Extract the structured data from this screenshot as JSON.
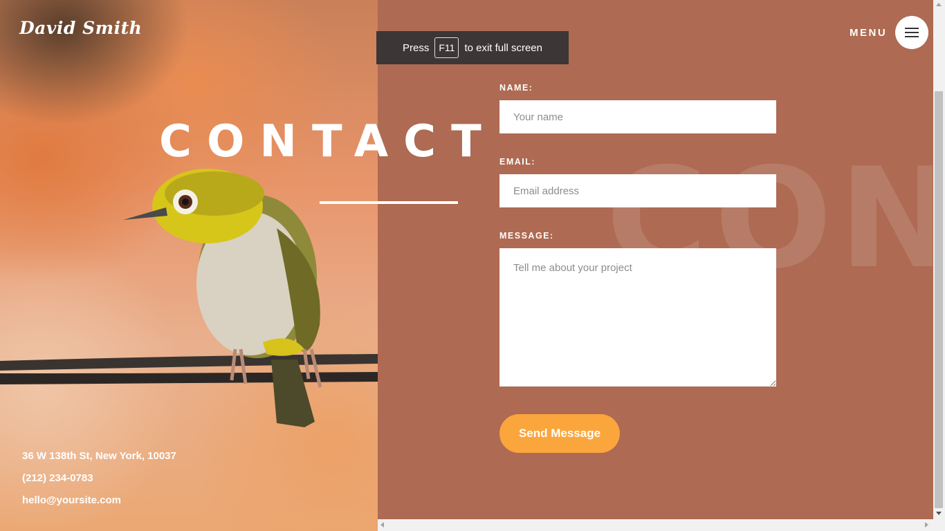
{
  "header": {
    "logo": "David Smith",
    "menu_label": "MENU",
    "menu_icon": "hamburger-icon"
  },
  "fullscreen_notice": {
    "prefix": "Press",
    "key": "F11",
    "suffix": "to exit full screen"
  },
  "hero": {
    "title": "CONTACT",
    "watermark": "CONT"
  },
  "contact_info": {
    "address": "36 W 138th St, New York, 10037",
    "phone": "(212) 234-0783",
    "email": "hello@yoursite.com"
  },
  "form": {
    "name_label": "NAME:",
    "name_placeholder": "Your name",
    "email_label": "EMAIL:",
    "email_placeholder": "Email address",
    "message_label": "MESSAGE:",
    "message_placeholder": "Tell me about your project",
    "submit_label": "Send Message"
  },
  "colors": {
    "panel_bg": "#ae6a52",
    "button_accent": "#fba63c",
    "toast_bg": "#3d3636"
  }
}
